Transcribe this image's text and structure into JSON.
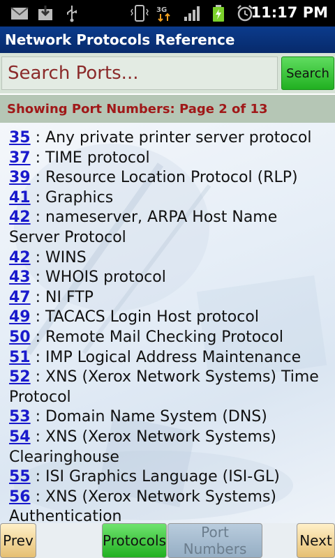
{
  "status_bar": {
    "time": "11:17 PM",
    "icons": [
      "gmail-icon",
      "download-icon",
      "usb-icon",
      "vibrate-icon",
      "3g-data-icon",
      "signal-icon",
      "battery-charging-icon",
      "alarm-icon"
    ]
  },
  "app": {
    "title": "Network Protocols Reference"
  },
  "search": {
    "placeholder": "Search Ports...",
    "value": "",
    "button_label": "Search"
  },
  "page_info": "Showing Port Numbers:  Page 2 of 13",
  "ports": [
    {
      "num": "35",
      "desc": " : Any private printer server protocol"
    },
    {
      "num": "37",
      "desc": " : TIME protocol"
    },
    {
      "num": "39",
      "desc": " : Resource Location Protocol (RLP)"
    },
    {
      "num": "41",
      "desc": " : Graphics"
    },
    {
      "num": "42",
      "desc": " : nameserver, ARPA Host Name Server Protocol"
    },
    {
      "num": "42",
      "desc": " : WINS"
    },
    {
      "num": "43",
      "desc": " : WHOIS protocol"
    },
    {
      "num": "47",
      "desc": " : NI FTP"
    },
    {
      "num": "49",
      "desc": " : TACACS Login Host protocol"
    },
    {
      "num": "50",
      "desc": " : Remote Mail Checking Protocol"
    },
    {
      "num": "51",
      "desc": " : IMP Logical Address Maintenance"
    },
    {
      "num": "52",
      "desc": " : XNS (Xerox Network Systems) Time Protocol"
    },
    {
      "num": "53",
      "desc": " : Domain Name System (DNS)"
    },
    {
      "num": "54",
      "desc": " : XNS (Xerox Network Systems) Clearinghouse"
    },
    {
      "num": "55",
      "desc": " : ISI Graphics Language (ISI-GL)"
    },
    {
      "num": "56",
      "desc": " : XNS (Xerox Network Systems) Authentication"
    }
  ],
  "nav": {
    "prev": "Prev",
    "protocols": "Protocols",
    "ports": "Port Numbers",
    "next": "Next"
  },
  "colors": {
    "title_bar": "#0b3b8c",
    "search_button": "#3fc43f",
    "page_info_bg": "#b5c6b5",
    "page_info_text": "#a01818",
    "link": "#1a1acc"
  }
}
